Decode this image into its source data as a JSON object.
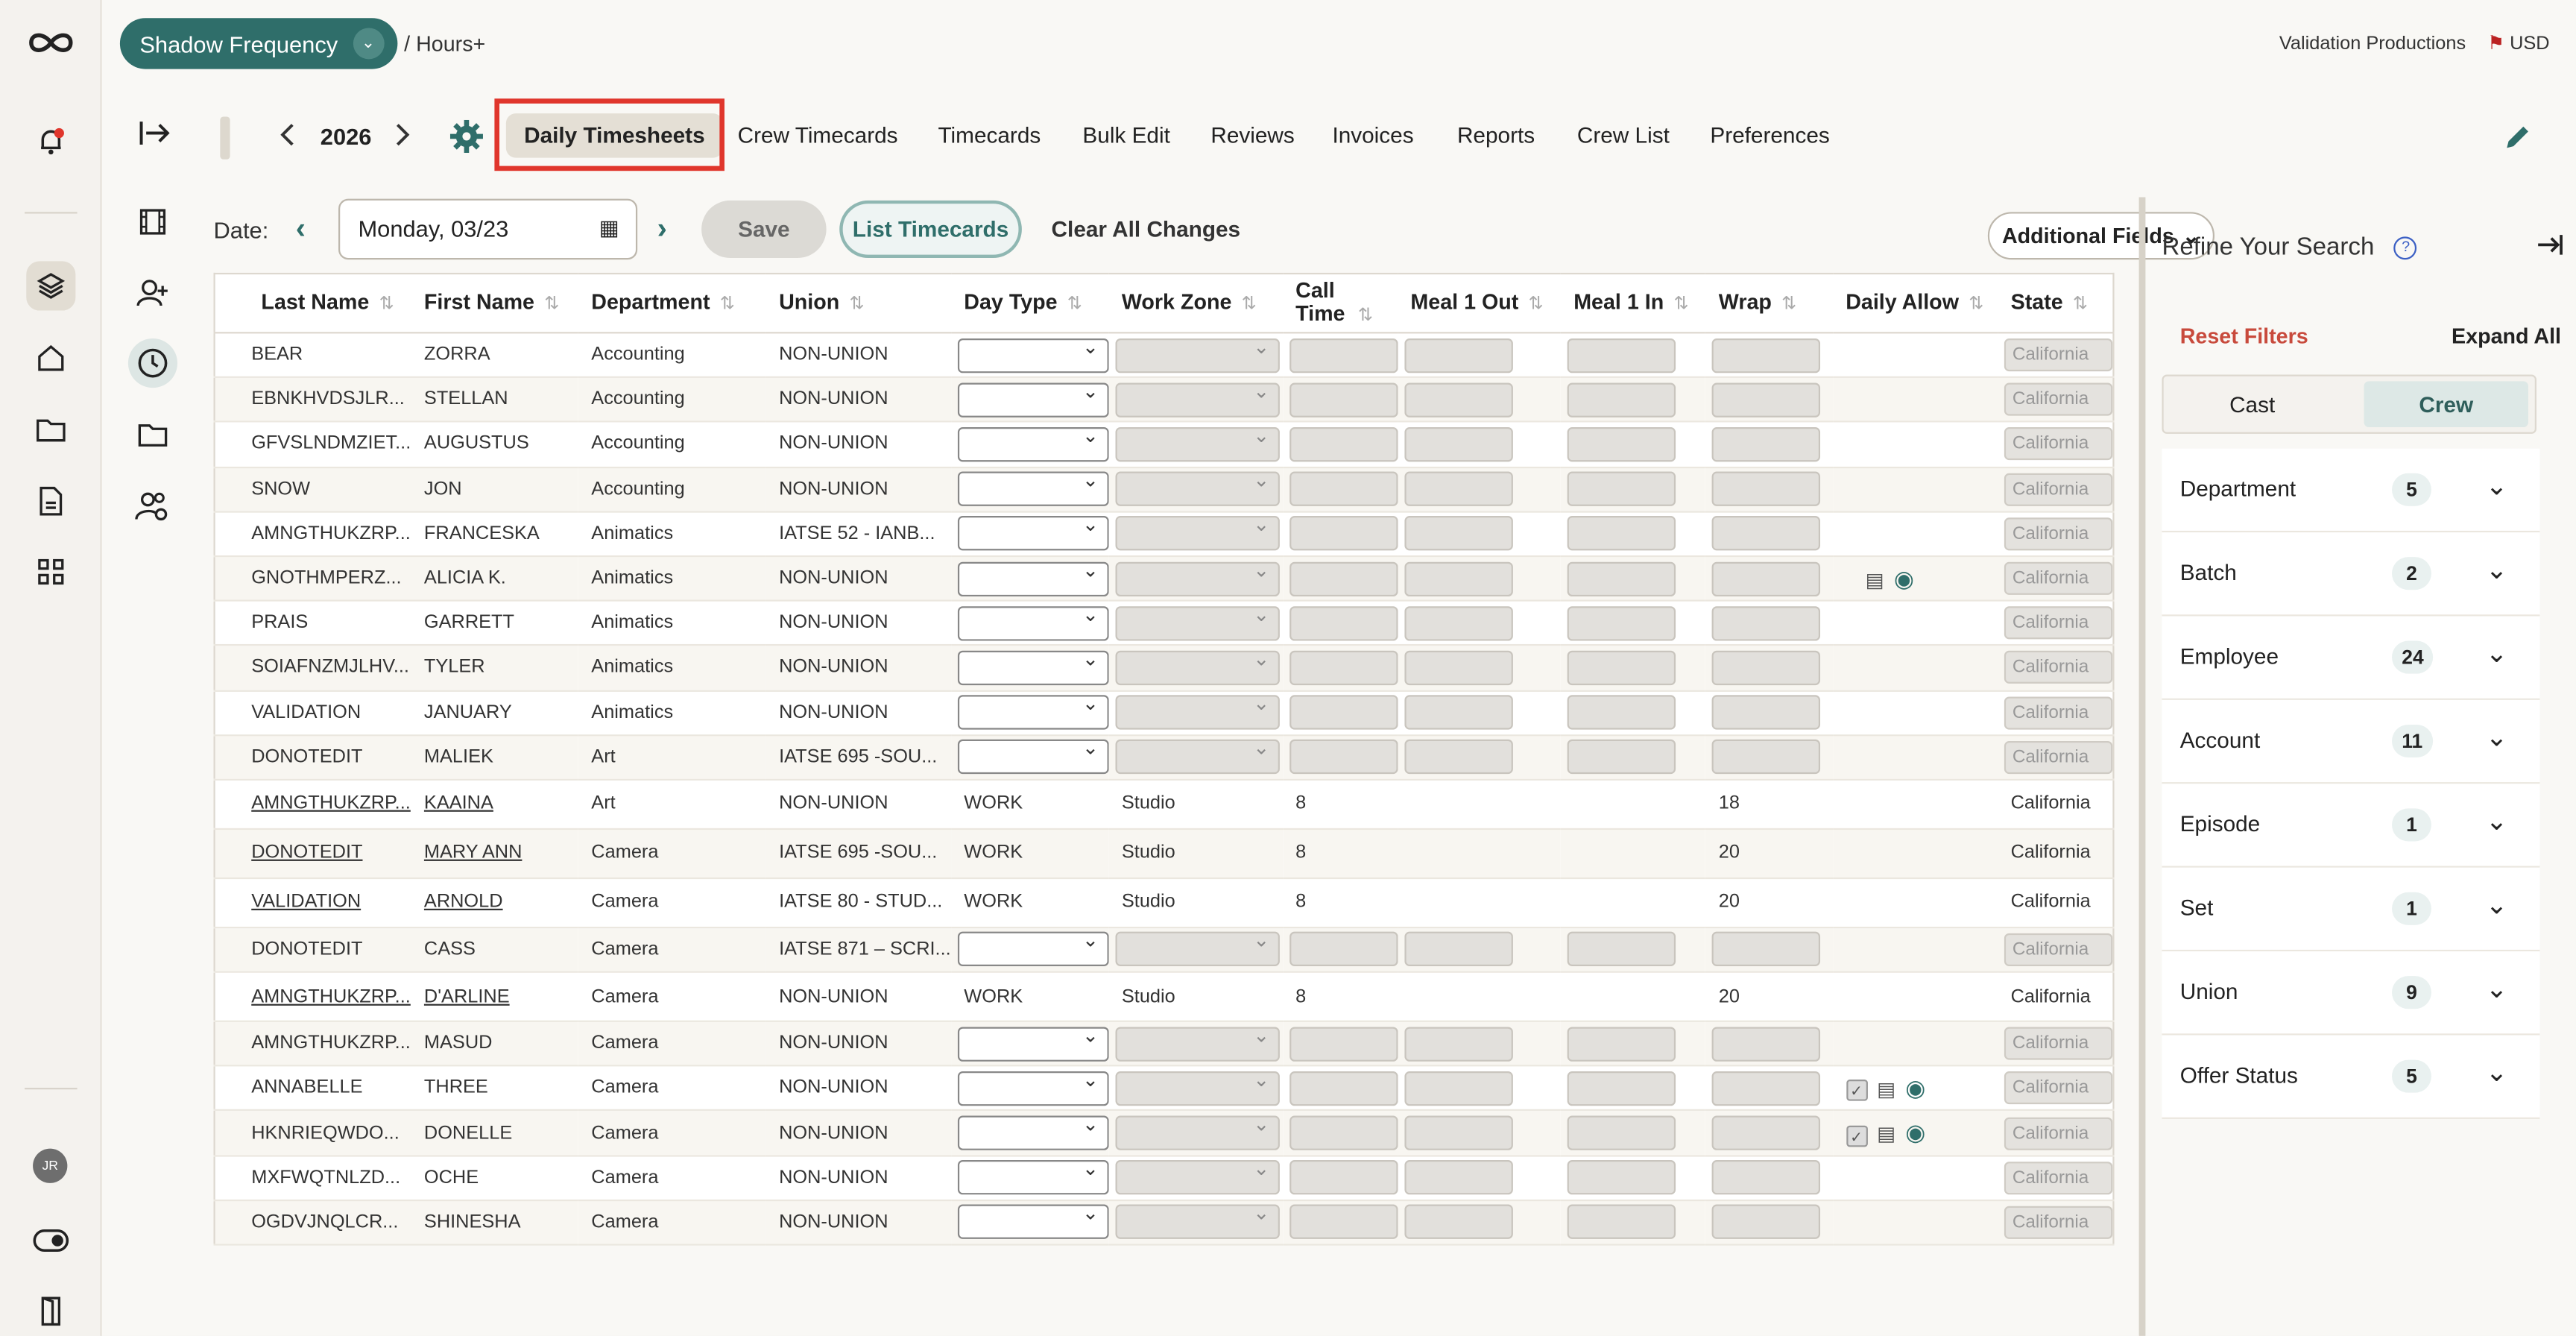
{
  "topbar": {
    "project": "Shadow Frequency",
    "breadcrumb": "/ Hours+",
    "company": "Validation Productions",
    "currency": "USD"
  },
  "nav": {
    "year": "2026",
    "tabs": [
      {
        "label": "Daily Timesheets",
        "active": true
      },
      {
        "label": "Crew Timecards"
      },
      {
        "label": "Timecards"
      },
      {
        "label": "Bulk Edit"
      },
      {
        "label": "Reviews"
      },
      {
        "label": "Invoices"
      },
      {
        "label": "Reports"
      },
      {
        "label": "Crew List"
      },
      {
        "label": "Preferences"
      }
    ]
  },
  "toolbar": {
    "date_label": "Date:",
    "date_value": "Monday, 03/23",
    "save": "Save",
    "list_timecards": "List Timecards",
    "clear": "Clear All Changes",
    "additional_fields": "Additional Fields"
  },
  "table": {
    "headers": [
      "Last Name",
      "First Name",
      "Department",
      "Union",
      "Day Type",
      "Work Zone",
      "Call Time",
      "Meal 1 Out",
      "Meal 1 In",
      "Wrap",
      "Daily Allow",
      "State"
    ],
    "rows": [
      {
        "last": "BEAR",
        "first": "ZORRA",
        "dept": "Accounting",
        "union": "NON-UNION",
        "state": "California"
      },
      {
        "last": "EBNKHVDSJLR...",
        "first": "STELLAN",
        "dept": "Accounting",
        "union": "NON-UNION",
        "state": "California"
      },
      {
        "last": "GFVSLNDMZIET...",
        "first": "AUGUSTUS",
        "dept": "Accounting",
        "union": "NON-UNION",
        "state": "California"
      },
      {
        "last": "SNOW",
        "first": "JON",
        "dept": "Accounting",
        "union": "NON-UNION",
        "state": "California"
      },
      {
        "last": "AMNGTHUKZRP...",
        "first": "FRANCESKA",
        "dept": "Animatics",
        "union": "IATSE 52 - IANB...",
        "state": "California"
      },
      {
        "last": "GNOTHMPERZ...",
        "first": "ALICIA K.",
        "dept": "Animatics",
        "union": "NON-UNION",
        "state": "California",
        "allow": "icons"
      },
      {
        "last": "PRAIS",
        "first": "GARRETT",
        "dept": "Animatics",
        "union": "NON-UNION",
        "state": "California"
      },
      {
        "last": "SOIAFNZMJLHV...",
        "first": "TYLER",
        "dept": "Animatics",
        "union": "NON-UNION",
        "state": "California"
      },
      {
        "last": "VALIDATION",
        "first": "JANUARY",
        "dept": "Animatics",
        "union": "NON-UNION",
        "state": "California"
      },
      {
        "last": "DONOTEDIT",
        "first": "MALIEK",
        "dept": "Art",
        "union": "IATSE 695 -SOU...",
        "state": "California"
      },
      {
        "last": "AMNGTHUKZRP...",
        "first": "KAAINA",
        "dept": "Art",
        "union": "NON-UNION",
        "day": "WORK",
        "zone": "Studio",
        "call": "8",
        "wrap": "18",
        "state": "California",
        "filled": true
      },
      {
        "last": "DONOTEDIT",
        "first": "MARY ANN",
        "dept": "Camera",
        "union": "IATSE 695 -SOU...",
        "day": "WORK",
        "zone": "Studio",
        "call": "8",
        "wrap": "20",
        "state": "California",
        "filled": true
      },
      {
        "last": "VALIDATION",
        "first": "ARNOLD",
        "dept": "Camera",
        "union": "IATSE 80 - STUD...",
        "day": "WORK",
        "zone": "Studio",
        "call": "8",
        "wrap": "20",
        "state": "California",
        "filled": true
      },
      {
        "last": "DONOTEDIT",
        "first": "CASS",
        "dept": "Camera",
        "union": "IATSE 871 – SCRI...",
        "state": "California"
      },
      {
        "last": "AMNGTHUKZRP...",
        "first": "D'ARLINE",
        "dept": "Camera",
        "union": "NON-UNION",
        "day": "WORK",
        "zone": "Studio",
        "call": "8",
        "wrap": "20",
        "state": "California",
        "filled": true
      },
      {
        "last": "AMNGTHUKZRP...",
        "first": "MASUD",
        "dept": "Camera",
        "union": "NON-UNION",
        "state": "California"
      },
      {
        "last": "ANNABELLE",
        "first": "THREE",
        "dept": "Camera",
        "union": "NON-UNION",
        "state": "California",
        "allow": "icons3"
      },
      {
        "last": "HKNRIEQWDO...",
        "first": "DONELLE",
        "dept": "Camera",
        "union": "NON-UNION",
        "state": "California",
        "allow": "icons3"
      },
      {
        "last": "MXFWQTNLZD...",
        "first": "OCHE",
        "dept": "Camera",
        "union": "NON-UNION",
        "state": "California"
      },
      {
        "last": "OGDVJNQLCR...",
        "first": "SHINESHA",
        "dept": "Camera",
        "union": "NON-UNION",
        "state": "California"
      }
    ]
  },
  "filters": {
    "title": "Refine Your Search",
    "reset": "Reset Filters",
    "expand": "Expand All",
    "segments": [
      "Cast",
      "Crew"
    ],
    "active_segment": "Crew",
    "items": [
      {
        "label": "Department",
        "count": "5"
      },
      {
        "label": "Batch",
        "count": "2"
      },
      {
        "label": "Employee",
        "count": "24"
      },
      {
        "label": "Account",
        "count": "11"
      },
      {
        "label": "Episode",
        "count": "1"
      },
      {
        "label": "Set",
        "count": "1"
      },
      {
        "label": "Union",
        "count": "9"
      },
      {
        "label": "Offer Status",
        "count": "5"
      }
    ]
  },
  "user": {
    "initials": "JR"
  },
  "colors": {
    "accent": "#2f6e6a",
    "highlight": "#e0362c",
    "reset": "#c84a3c"
  }
}
